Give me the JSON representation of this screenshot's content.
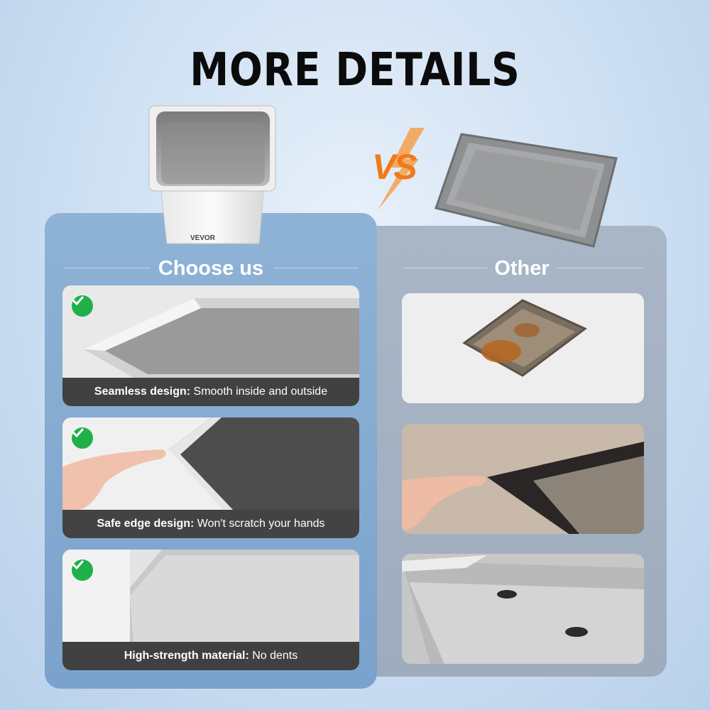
{
  "header": {
    "title": "MORE DETAILS"
  },
  "comparison": {
    "vs_label": "VS",
    "left_title": "Choose us",
    "right_title": "Other",
    "brand_mark": "VEVOR",
    "features": [
      {
        "bold": "Seamless design:",
        "text": " Smooth inside and outside"
      },
      {
        "bold": "Safe edge design:",
        "text": " Won't scratch your hands"
      },
      {
        "bold": "High-strength material:",
        "text": " No dents"
      }
    ]
  },
  "colors": {
    "left_panel": "#7aa2cc",
    "right_panel": "#a4b2c4",
    "check_green": "#20b04a",
    "vs_orange": "#f07a1a"
  },
  "icons": [
    "check-circle-icon",
    "check-circle-icon",
    "check-circle-icon"
  ]
}
